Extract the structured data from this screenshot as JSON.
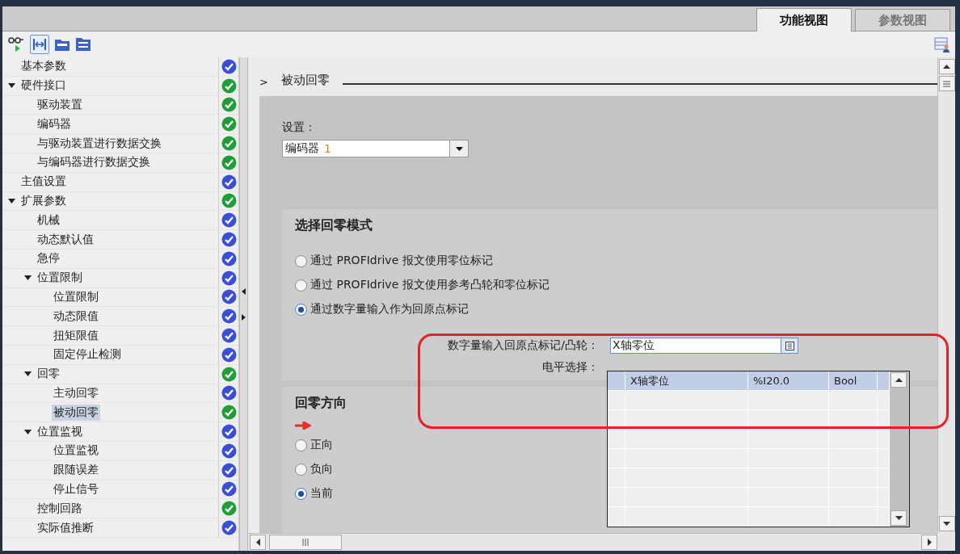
{
  "tabs": [
    {
      "label": "功能视图",
      "selected": true
    },
    {
      "label": "参数视图",
      "selected": false
    }
  ],
  "tree": [
    {
      "label": "基本参数",
      "color": "#3a4ed6",
      "selected": false
    },
    {
      "label": "硬件接口",
      "color": "#1e9e35",
      "selected": false,
      "expanded": true,
      "children": [
        {
          "label": "驱动装置",
          "color": "#1e9e35",
          "selected": false
        },
        {
          "label": "编码器",
          "color": "#1e9e35",
          "selected": false
        },
        {
          "label": "与驱动装置进行数据交换",
          "color": "#1e9e35",
          "selected": false
        },
        {
          "label": "与编码器进行数据交换",
          "color": "#1e9e35",
          "selected": false
        }
      ]
    },
    {
      "label": "主值设置",
      "color": "#3a4ed6",
      "selected": false
    },
    {
      "label": "扩展参数",
      "color": "#1e9e35",
      "selected": false,
      "expanded": true,
      "children": [
        {
          "label": "机械",
          "color": "#3a4ed6",
          "selected": false
        },
        {
          "label": "动态默认值",
          "color": "#3a4ed6",
          "selected": false
        },
        {
          "label": "急停",
          "color": "#3a4ed6",
          "selected": false
        },
        {
          "label": "位置限制",
          "color": "#3a4ed6",
          "selected": false,
          "expanded": true,
          "children": [
            {
              "label": "位置限制",
              "color": "#3a4ed6",
              "selected": false
            },
            {
              "label": "动态限值",
              "color": "#3a4ed6",
              "selected": false
            },
            {
              "label": "扭矩限值",
              "color": "#3a4ed6",
              "selected": false
            },
            {
              "label": "固定停止检测",
              "color": "#3a4ed6",
              "selected": false
            }
          ]
        },
        {
          "label": "回零",
          "color": "#1e9e35",
          "selected": false,
          "expanded": true,
          "children": [
            {
              "label": "主动回零",
              "color": "#3a4ed6",
              "selected": false
            },
            {
              "label": "被动回零",
              "color": "#1e9e35",
              "selected": true
            }
          ]
        },
        {
          "label": "位置监视",
          "color": "#3a4ed6",
          "selected": false,
          "expanded": true,
          "children": [
            {
              "label": "位置监视",
              "color": "#3a4ed6",
              "selected": false
            },
            {
              "label": "跟随误差",
              "color": "#3a4ed6",
              "selected": false
            },
            {
              "label": "停止信号",
              "color": "#3a4ed6",
              "selected": false
            }
          ]
        },
        {
          "label": "控制回路",
          "color": "#1e9e35",
          "selected": false
        },
        {
          "label": "实际值推断",
          "color": "#3a4ed6",
          "selected": false
        }
      ]
    }
  ],
  "content": {
    "breadcrumb": ">",
    "title": "被动回零",
    "settings": {
      "label": "设置：",
      "value_name": "编码器",
      "value_number": "1"
    },
    "mode": {
      "title": "选择回零模式",
      "options": [
        {
          "label": "通过 PROFIdrive 报文使用零位标记",
          "selected": false
        },
        {
          "label": "通过 PROFIdrive 报文使用参考凸轮和零位标记",
          "selected": false
        },
        {
          "label": "通过数字量输入作为回原点标记",
          "selected": true
        }
      ],
      "input_label": "数字量输入回原点标记/凸轮：",
      "input_value": "X轴零位",
      "level_label": "电平选择："
    },
    "direction": {
      "title": "回零方向",
      "options": [
        {
          "label": "正向",
          "selected": false
        },
        {
          "label": "负向",
          "selected": false
        },
        {
          "label": "当前",
          "selected": true
        }
      ]
    }
  },
  "popup": {
    "rows": [
      {
        "cells": [
          "X轴零位",
          "%I20.0",
          "Bool"
        ],
        "selected": true
      }
    ]
  }
}
